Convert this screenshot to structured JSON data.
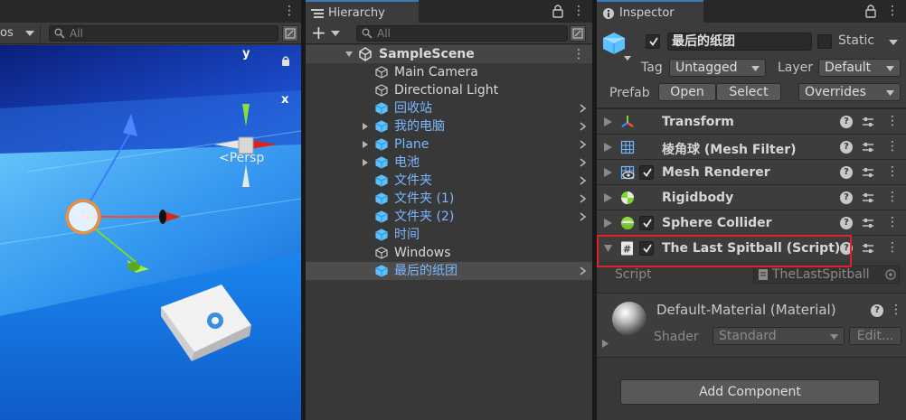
{
  "scene": {
    "toolbar_partial_label": "os",
    "search_placeholder": "All",
    "gizmo": {
      "y_label": "y",
      "x_label": "x",
      "persp_label": "<Persp"
    }
  },
  "hierarchy": {
    "tab_title": "Hierarchy",
    "add_label": "+",
    "search_placeholder": "All",
    "scene_name": "SampleScene",
    "items": [
      {
        "label": "Main Camera",
        "style": "white",
        "expandable": false,
        "has_chevron": false
      },
      {
        "label": "Directional Light",
        "style": "white",
        "expandable": false,
        "has_chevron": false
      },
      {
        "label": "回收站",
        "style": "prefab",
        "expandable": false,
        "has_chevron": true
      },
      {
        "label": "我的电脑",
        "style": "prefab",
        "expandable": true,
        "has_chevron": true
      },
      {
        "label": "Plane",
        "style": "prefab",
        "expandable": true,
        "has_chevron": true
      },
      {
        "label": "电池",
        "style": "prefab",
        "expandable": true,
        "has_chevron": true
      },
      {
        "label": "文件夹",
        "style": "prefab",
        "expandable": false,
        "has_chevron": true
      },
      {
        "label": "文件夹 (1)",
        "style": "prefab",
        "expandable": false,
        "has_chevron": true
      },
      {
        "label": "文件夹 (2)",
        "style": "prefab",
        "expandable": false,
        "has_chevron": true
      },
      {
        "label": "时间",
        "style": "prefab",
        "expandable": false,
        "has_chevron": false
      },
      {
        "label": "Windows",
        "style": "white",
        "expandable": false,
        "has_chevron": false
      },
      {
        "label": "最后的纸团",
        "style": "prefab-selected",
        "expandable": false,
        "has_chevron": true
      }
    ]
  },
  "inspector": {
    "tab_title": "Inspector",
    "object_name": "最后的纸团",
    "static_label": "Static",
    "tag_label": "Tag",
    "tag_value": "Untagged",
    "layer_label": "Layer",
    "layer_value": "Default",
    "prefab_label": "Prefab",
    "open_label": "Open",
    "select_label": "Select",
    "overrides_label": "Overrides",
    "components": [
      {
        "name": "Transform",
        "icon": "transform-icon",
        "has_checkbox": false
      },
      {
        "name": "棱角球 (Mesh Filter)",
        "icon": "mesh-filter-icon",
        "has_checkbox": false
      },
      {
        "name": "Mesh Renderer",
        "icon": "mesh-renderer-icon",
        "has_checkbox": true
      },
      {
        "name": "Rigidbody",
        "icon": "rigidbody-icon",
        "has_checkbox": false
      },
      {
        "name": "Sphere Collider",
        "icon": "sphere-collider-icon",
        "has_checkbox": true
      },
      {
        "name": "The Last Spitball (Script)",
        "icon": "script-icon",
        "has_checkbox": true
      }
    ],
    "script_label": "Script",
    "script_value": "TheLastSpitball",
    "material_name": "Default-Material (Material)",
    "shader_label": "Shader",
    "shader_value": "Standard",
    "edit_label": "Edit...",
    "add_component_label": "Add Component",
    "highlight_color": "#e0202a",
    "accent_color": "#3a79bb",
    "prefab_text_color": "#7cb7ff"
  }
}
